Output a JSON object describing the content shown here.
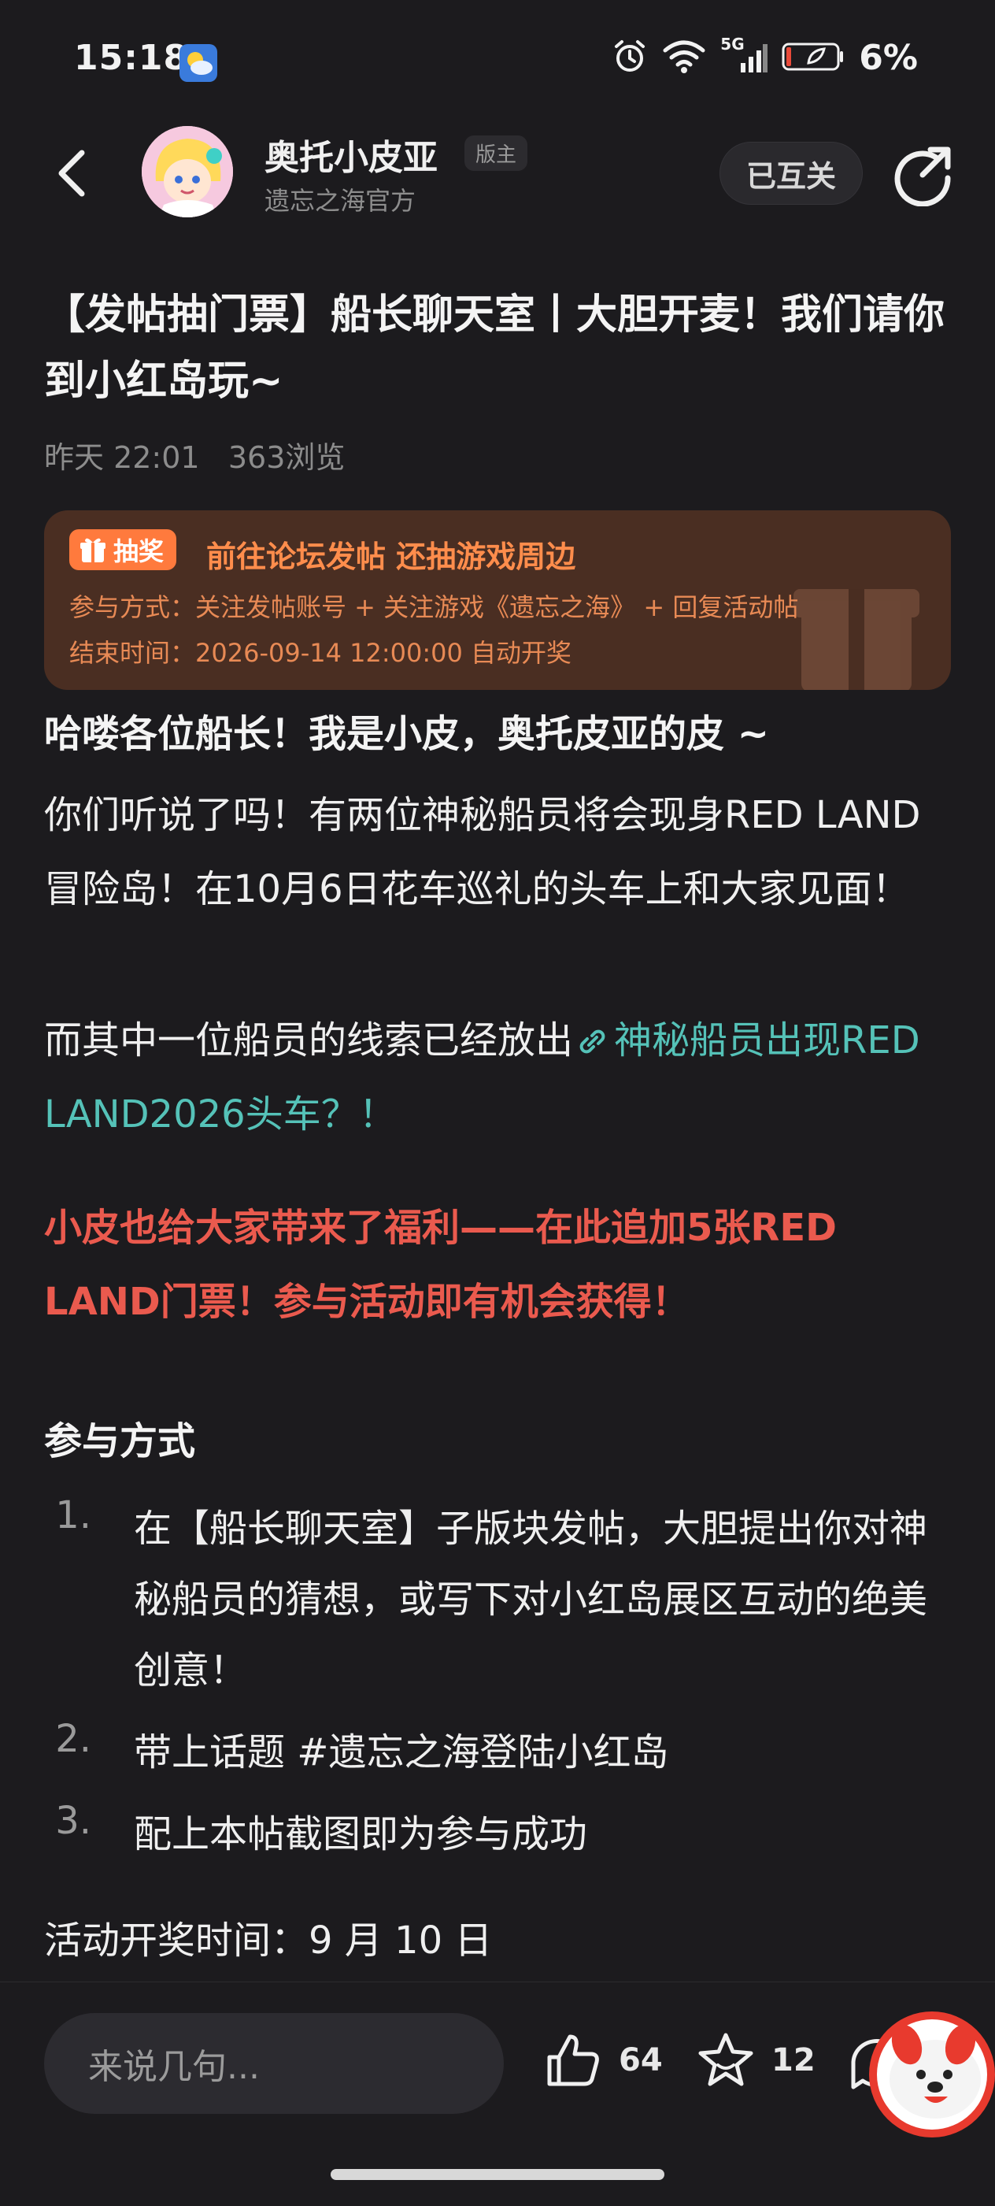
{
  "status_bar": {
    "time": "15:18",
    "network": "5G",
    "battery": "6%"
  },
  "header": {
    "author_name": "奥托小皮亚",
    "author_badge": "版主",
    "author_subtitle": "遗忘之海官方",
    "follow_label": "已互关"
  },
  "post": {
    "title": "【发帖抽门票】船长聊天室丨大胆开麦！我们请你到小红岛玩~",
    "time": "昨天 22:01",
    "views": "363浏览"
  },
  "lottery": {
    "badge": "抽奖",
    "headline": "前往论坛发帖 还抽游戏周边",
    "method": "参与方式：关注发帖账号 + 关注游戏《遗忘之海》 + 回复活动帖",
    "end_time": "结束时间：2026-09-14 12:00:00 自动开奖"
  },
  "body": {
    "greeting": "哈喽各位船长！我是小皮，奥托皮亚的皮 ~",
    "para1": "你们听说了吗！有两位神秘船员将会现身RED LAND冒险岛！在10月6日花车巡礼的头车上和大家见面！",
    "para2_prefix": "而其中一位船员的线索已经放出",
    "para2_link": "神秘船员出现RED LAND2026头车？！",
    "highlight": "小皮也给大家带来了福利——在此追加5张RED LAND门票！参与活动即有机会获得！",
    "section_title": "参与方式",
    "list": [
      {
        "num": "1.",
        "text": "在【船长聊天室】子版块发帖，大胆提出你对神秘船员的猜想，或写下对小红岛展区互动的绝美创意！"
      },
      {
        "num": "2.",
        "text": "带上话题 #遗忘之海登陆小红岛"
      },
      {
        "num": "3.",
        "text": "配上本帖截图即为参与成功"
      }
    ],
    "draw_time": "活动开奖时间：9 月 10 日"
  },
  "bottom_bar": {
    "comment_placeholder": "来说几句...",
    "likes": "64",
    "favorites": "12"
  },
  "colors": {
    "background": "#1c1b1e",
    "accent_orange": "#ff8d4c",
    "link_teal": "#55c2b8",
    "highlight_red": "#ea5a4e"
  },
  "icons": [
    "back-arrow-icon",
    "share-icon",
    "gift-icon",
    "link-icon",
    "like-icon",
    "star-icon",
    "comment-icon",
    "alarm-icon",
    "wifi-icon",
    "signal-icon",
    "battery-icon",
    "weather-icon"
  ]
}
